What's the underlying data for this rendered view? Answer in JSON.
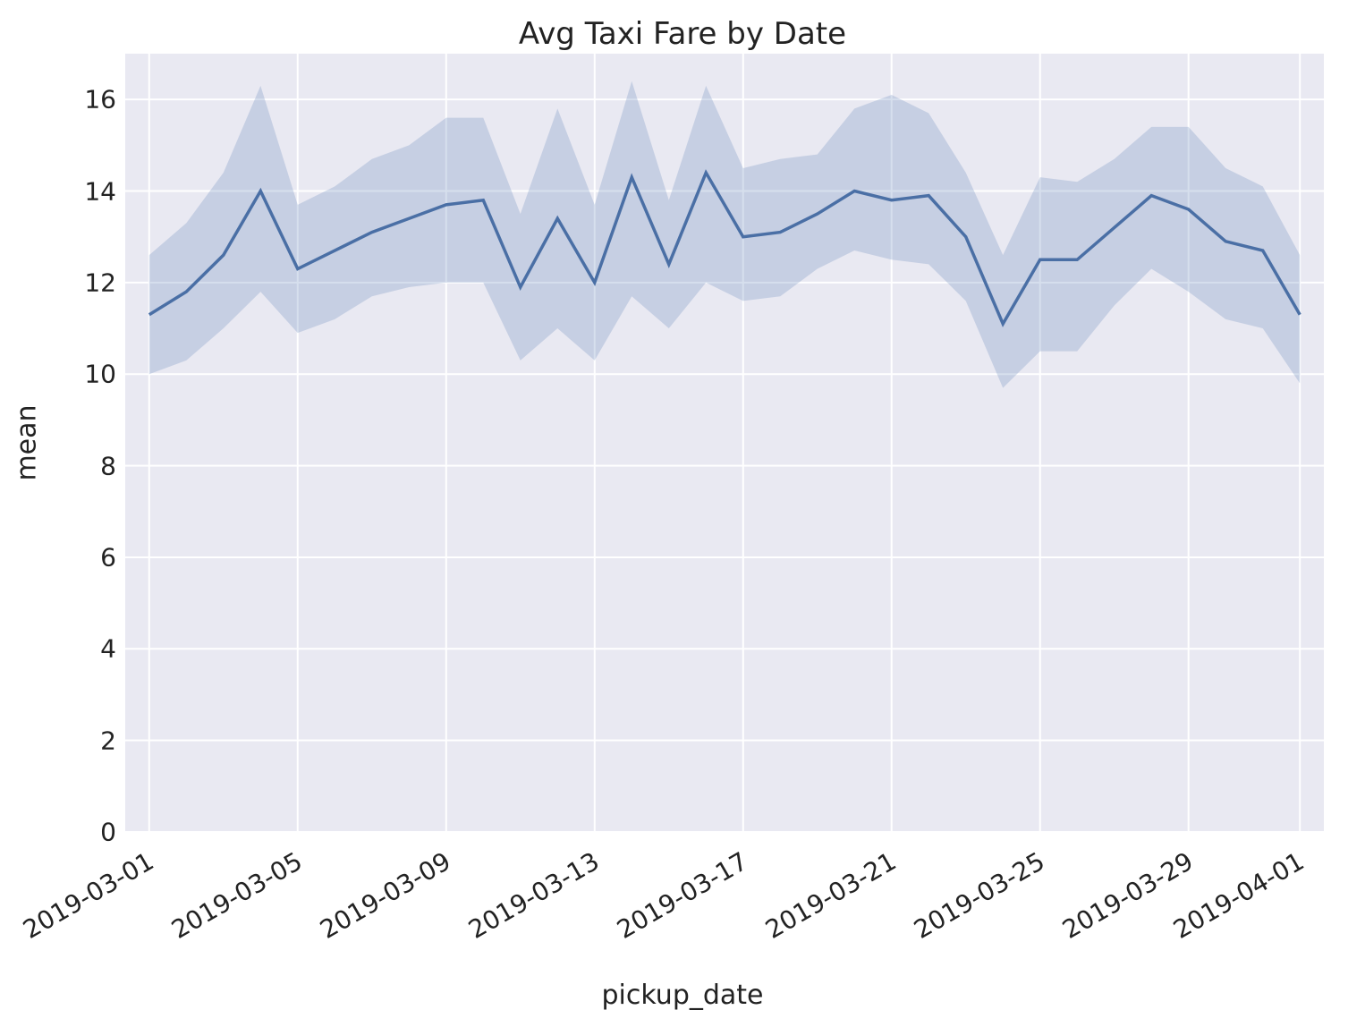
{
  "chart_data": {
    "type": "line",
    "title": "Avg Taxi Fare by Date",
    "xlabel": "pickup_date",
    "ylabel": "mean",
    "ylim": [
      0,
      17
    ],
    "y_ticks": [
      0,
      2,
      4,
      6,
      8,
      10,
      12,
      14,
      16
    ],
    "x_tick_labels": [
      "2019-03-01",
      "2019-03-05",
      "2019-03-09",
      "2019-03-13",
      "2019-03-17",
      "2019-03-21",
      "2019-03-25",
      "2019-03-29",
      "2019-04-01"
    ],
    "x_tick_indices": [
      0,
      4,
      8,
      12,
      16,
      20,
      24,
      28,
      31
    ],
    "series": [
      {
        "name": "mean",
        "x": [
          "2019-03-01",
          "2019-03-02",
          "2019-03-03",
          "2019-03-04",
          "2019-03-05",
          "2019-03-06",
          "2019-03-07",
          "2019-03-08",
          "2019-03-09",
          "2019-03-10",
          "2019-03-11",
          "2019-03-12",
          "2019-03-13",
          "2019-03-14",
          "2019-03-15",
          "2019-03-16",
          "2019-03-17",
          "2019-03-18",
          "2019-03-19",
          "2019-03-20",
          "2019-03-21",
          "2019-03-22",
          "2019-03-23",
          "2019-03-24",
          "2019-03-25",
          "2019-03-26",
          "2019-03-27",
          "2019-03-28",
          "2019-03-29",
          "2019-03-30",
          "2019-03-31",
          "2019-04-01"
        ],
        "values": [
          11.3,
          11.8,
          12.6,
          14.0,
          12.3,
          12.7,
          13.1,
          13.4,
          13.7,
          13.8,
          11.9,
          13.4,
          12.0,
          14.3,
          12.4,
          14.4,
          13.0,
          13.1,
          13.5,
          14.0,
          13.8,
          13.9,
          13.0,
          11.1,
          12.5,
          12.5,
          13.2,
          13.9,
          13.6,
          12.9,
          12.7,
          11.3
        ],
        "ci_lower": [
          10.0,
          10.3,
          11.0,
          11.8,
          10.9,
          11.2,
          11.7,
          11.9,
          12.0,
          12.0,
          10.3,
          11.0,
          10.3,
          11.7,
          11.0,
          12.0,
          11.6,
          11.7,
          12.3,
          12.7,
          12.5,
          12.4,
          11.6,
          9.7,
          10.5,
          10.5,
          11.5,
          12.3,
          11.8,
          11.2,
          11.0,
          9.8
        ],
        "ci_upper": [
          12.6,
          13.3,
          14.4,
          16.3,
          13.7,
          14.1,
          14.7,
          15.0,
          15.6,
          15.6,
          13.5,
          15.8,
          13.7,
          16.4,
          13.8,
          16.3,
          14.5,
          14.7,
          14.8,
          15.8,
          16.1,
          15.7,
          14.4,
          12.6,
          14.3,
          14.2,
          14.7,
          15.4,
          15.4,
          14.5,
          14.1,
          12.6
        ]
      }
    ]
  }
}
